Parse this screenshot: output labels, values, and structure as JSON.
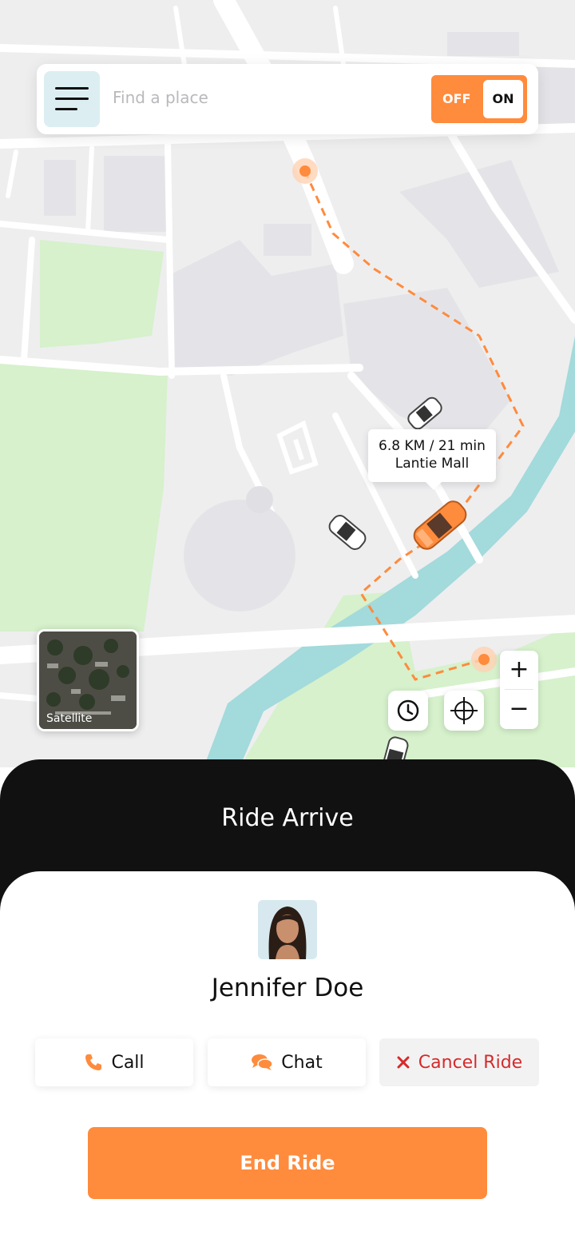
{
  "search": {
    "placeholder": "Find a place"
  },
  "toggle": {
    "off_label": "OFF",
    "on_label": "ON"
  },
  "route": {
    "distance_time": "6.8 KM / 21 min",
    "destination": "Lantie Mall"
  },
  "map_controls": {
    "satellite_label": "Satellite",
    "zoom_in": "+",
    "zoom_out": "−"
  },
  "sheet": {
    "title": "Ride Arrive"
  },
  "driver": {
    "name": "Jennifer Doe"
  },
  "actions": {
    "call": "Call",
    "chat": "Chat",
    "cancel": "Cancel Ride"
  },
  "primary": {
    "end_ride": "End Ride"
  },
  "colors": {
    "accent": "#ff8b3d",
    "danger": "#d62a2a",
    "water": "#a3dadc",
    "park": "#d6f1cc",
    "sheet_dark": "#111111"
  }
}
